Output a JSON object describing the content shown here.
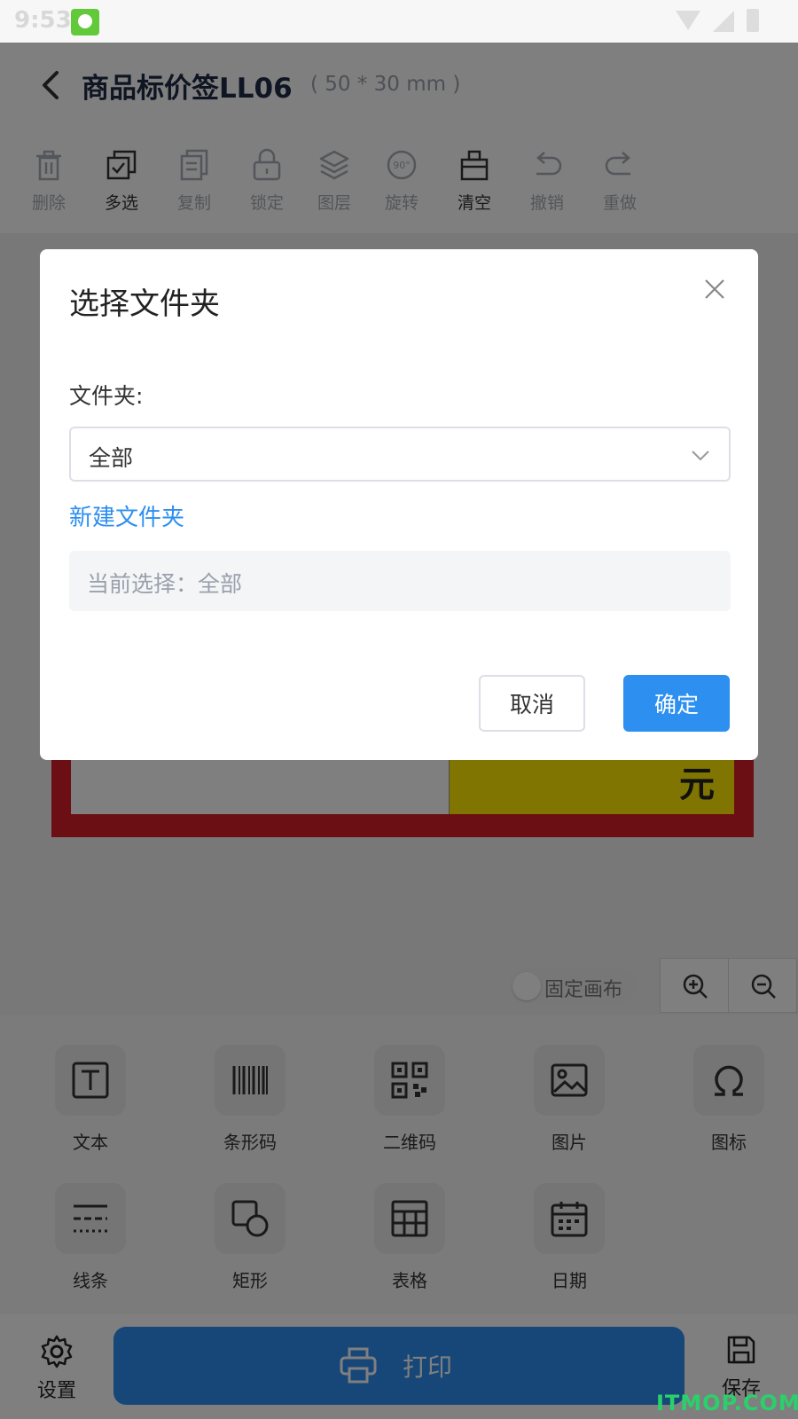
{
  "status_bar": {
    "time": "9:53"
  },
  "header": {
    "title": "商品标价签LL06",
    "size": "( 50 * 30 mm )"
  },
  "toolbar": {
    "items": [
      {
        "label": "删除",
        "icon": "trash-icon",
        "active": false
      },
      {
        "label": "多选",
        "icon": "multiselect-icon",
        "active": true
      },
      {
        "label": "复制",
        "icon": "copy-icon",
        "active": false
      },
      {
        "label": "锁定",
        "icon": "lock-icon",
        "active": false
      },
      {
        "label": "图层",
        "icon": "layers-icon",
        "active": false
      },
      {
        "label": "旋转",
        "icon": "rotate-90-icon",
        "active": false
      },
      {
        "label": "清空",
        "icon": "clear-icon",
        "active": true
      },
      {
        "label": "撤销",
        "icon": "undo-icon",
        "active": false
      },
      {
        "label": "重做",
        "icon": "redo-icon",
        "active": false
      }
    ]
  },
  "canvas": {
    "price_unit": "元",
    "fixed_canvas_label": "固定画布",
    "colors": {
      "border": "#d81e2a",
      "price_bg": "#ffea00"
    }
  },
  "elements": {
    "items": [
      {
        "label": "文本",
        "icon": "text-icon"
      },
      {
        "label": "条形码",
        "icon": "barcode-icon"
      },
      {
        "label": "二维码",
        "icon": "qrcode-icon"
      },
      {
        "label": "图片",
        "icon": "image-icon"
      },
      {
        "label": "图标",
        "icon": "omega-icon"
      },
      {
        "label": "线条",
        "icon": "lines-icon"
      },
      {
        "label": "矩形",
        "icon": "shape-icon"
      },
      {
        "label": "表格",
        "icon": "table-icon"
      },
      {
        "label": "日期",
        "icon": "calendar-icon"
      }
    ]
  },
  "bottom_bar": {
    "settings_label": "设置",
    "print_label": "打印",
    "save_label": "保存"
  },
  "watermark": "ITMOP.COM",
  "dialog": {
    "title": "选择文件夹",
    "folder_label": "文件夹:",
    "folder_value": "全部",
    "new_folder_label": "新建文件夹",
    "current_selection": "当前选择：全部",
    "cancel_label": "取消",
    "ok_label": "确定",
    "accent_color": "#2d8ff0"
  }
}
